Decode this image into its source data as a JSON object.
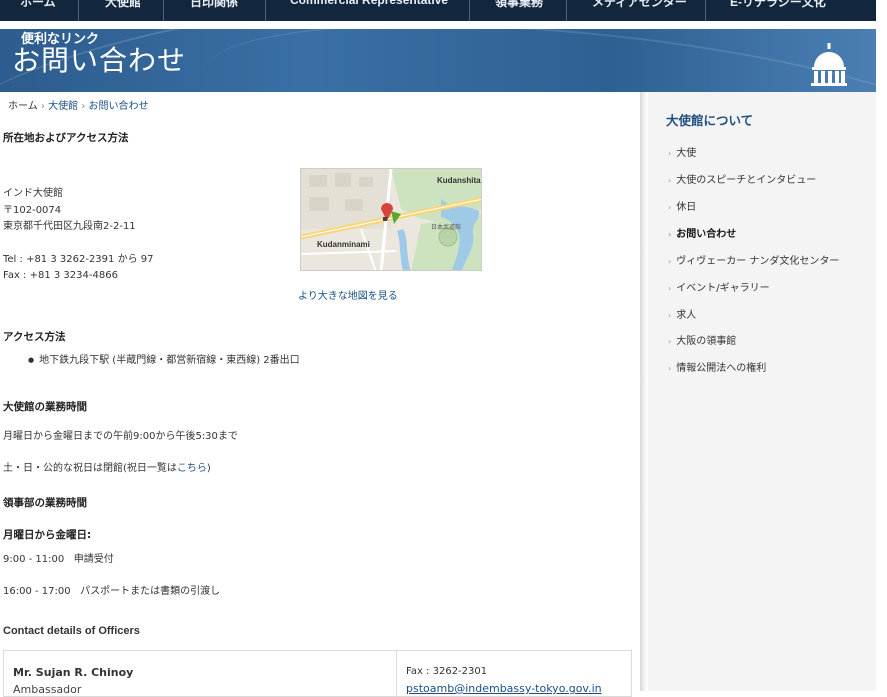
{
  "topnav": {
    "items": [
      "ホーム",
      "大使館",
      "日印関係",
      "Commercial Representative",
      "領事業務",
      "メディアセンター",
      "E-リテラシー文化"
    ]
  },
  "banner": {
    "subtitle": "便利なリンク",
    "title": "お問い合わせ"
  },
  "breadcrumb": {
    "home": "ホーム",
    "sep": "›",
    "embassy": "大使館",
    "current": "お問い合わせ"
  },
  "location": {
    "heading": "所在地およびアクセス方法",
    "name": "インド大使館",
    "postal": "〒102-0074",
    "address": "東京都千代田区九段南2-2-11",
    "tel": "Tel : +81 3 3262-2391 から 97",
    "fax": "Fax : +81 3 3234-4866",
    "map_link": "より大きな地図を見る",
    "map_labels": {
      "kudanshita": "Kudanshita",
      "kudanminami": "Kudanminami",
      "budokan": "日本武道館"
    }
  },
  "access": {
    "heading": "アクセス方法",
    "items": [
      "地下鉄九段下駅 (半蔵門線・都営新宿線・東西線) 2番出口"
    ]
  },
  "hours": {
    "heading": "大使館の業務時間",
    "weekday": "月曜日から金曜日までの午前9:00から午後5:30まで",
    "holiday_pre": "土・日・公的な祝日は閉館(祝日一覧は",
    "holiday_link": "こちら",
    "holiday_post": ")"
  },
  "consular": {
    "heading": "領事部の業務時間",
    "sub_heading": "月曜日から金曜日:",
    "slot1_time": "9:00 - 11:00",
    "slot1_desc": "申請受付",
    "slot2_time": "16:00 - 17:00",
    "slot2_desc": "パスポートまたは書類の引渡し"
  },
  "officers": {
    "heading": "Contact details of Officers",
    "name": "Mr. Sujan R. Chinoy",
    "title": "Ambassador",
    "fax": "Fax : 3262-2301",
    "email": "pstoamb@indembassy-tokyo.gov.in"
  },
  "sidebar": {
    "title": "大使館について",
    "items": [
      {
        "label": "大使"
      },
      {
        "label": "大使のスピーチとインタビュー"
      },
      {
        "label": "休日"
      },
      {
        "label": "お問い合わせ"
      },
      {
        "label": "ヴィヴェーカー ナンダ文化センター"
      },
      {
        "label": "イベント/ギャラリー"
      },
      {
        "label": "求人"
      },
      {
        "label": "大阪の領事館"
      },
      {
        "label": "情報公開法への権利"
      }
    ]
  },
  "colors": {
    "nav_bg": "#12263d",
    "banner": "#3a6fa5",
    "link": "#1a4f86",
    "sidebar_title": "#1f4f82"
  }
}
